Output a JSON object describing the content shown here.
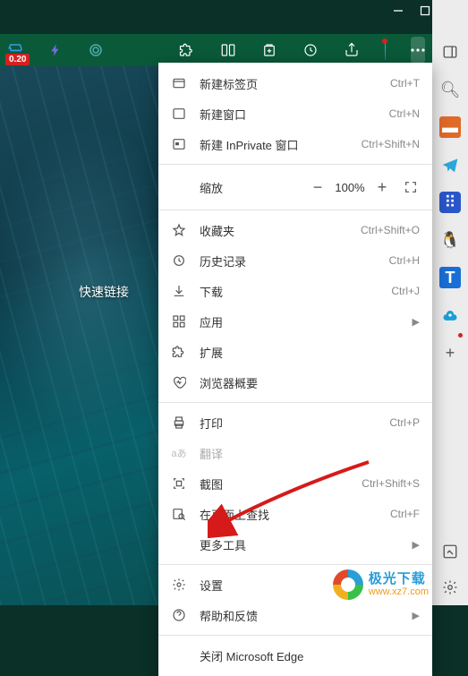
{
  "window": {
    "badge": "0.20"
  },
  "content": {
    "quick_links": "快速链接"
  },
  "sidebar": {
    "items": [
      {
        "name": "panel",
        "glyph": "⧉"
      },
      {
        "name": "search",
        "glyph": "🔍"
      },
      {
        "name": "briefcase",
        "glyph": "▭"
      },
      {
        "name": "telegram",
        "glyph": "➤"
      },
      {
        "name": "grid",
        "glyph": "⊞"
      },
      {
        "name": "penguin",
        "glyph": "🐧"
      },
      {
        "name": "t",
        "glyph": "T"
      },
      {
        "name": "cloud",
        "glyph": "☁"
      },
      {
        "name": "plus",
        "glyph": "+"
      }
    ]
  },
  "menu": {
    "new_tab": {
      "label": "新建标签页",
      "shortcut": "Ctrl+T"
    },
    "new_window": {
      "label": "新建窗口",
      "shortcut": "Ctrl+N"
    },
    "new_inprivate": {
      "label": "新建 InPrivate 窗口",
      "shortcut": "Ctrl+Shift+N"
    },
    "zoom": {
      "label": "缩放",
      "value": "100%"
    },
    "favorites": {
      "label": "收藏夹",
      "shortcut": "Ctrl+Shift+O"
    },
    "history": {
      "label": "历史记录",
      "shortcut": "Ctrl+H"
    },
    "downloads": {
      "label": "下载",
      "shortcut": "Ctrl+J"
    },
    "apps": {
      "label": "应用"
    },
    "extensions": {
      "label": "扩展"
    },
    "browser_essentials": {
      "label": "浏览器概要"
    },
    "print": {
      "label": "打印",
      "shortcut": "Ctrl+P"
    },
    "translate": {
      "label": "翻译"
    },
    "screenshot": {
      "label": "截图",
      "shortcut": "Ctrl+Shift+S"
    },
    "find": {
      "label": "在页面上查找",
      "shortcut": "Ctrl+F"
    },
    "more_tools": {
      "label": "更多工具"
    },
    "settings": {
      "label": "设置"
    },
    "help": {
      "label": "帮助和反馈"
    },
    "close": {
      "label": "关闭 Microsoft Edge"
    }
  },
  "watermark": {
    "line1": "极光下载",
    "line2": "www.xz7.com"
  }
}
